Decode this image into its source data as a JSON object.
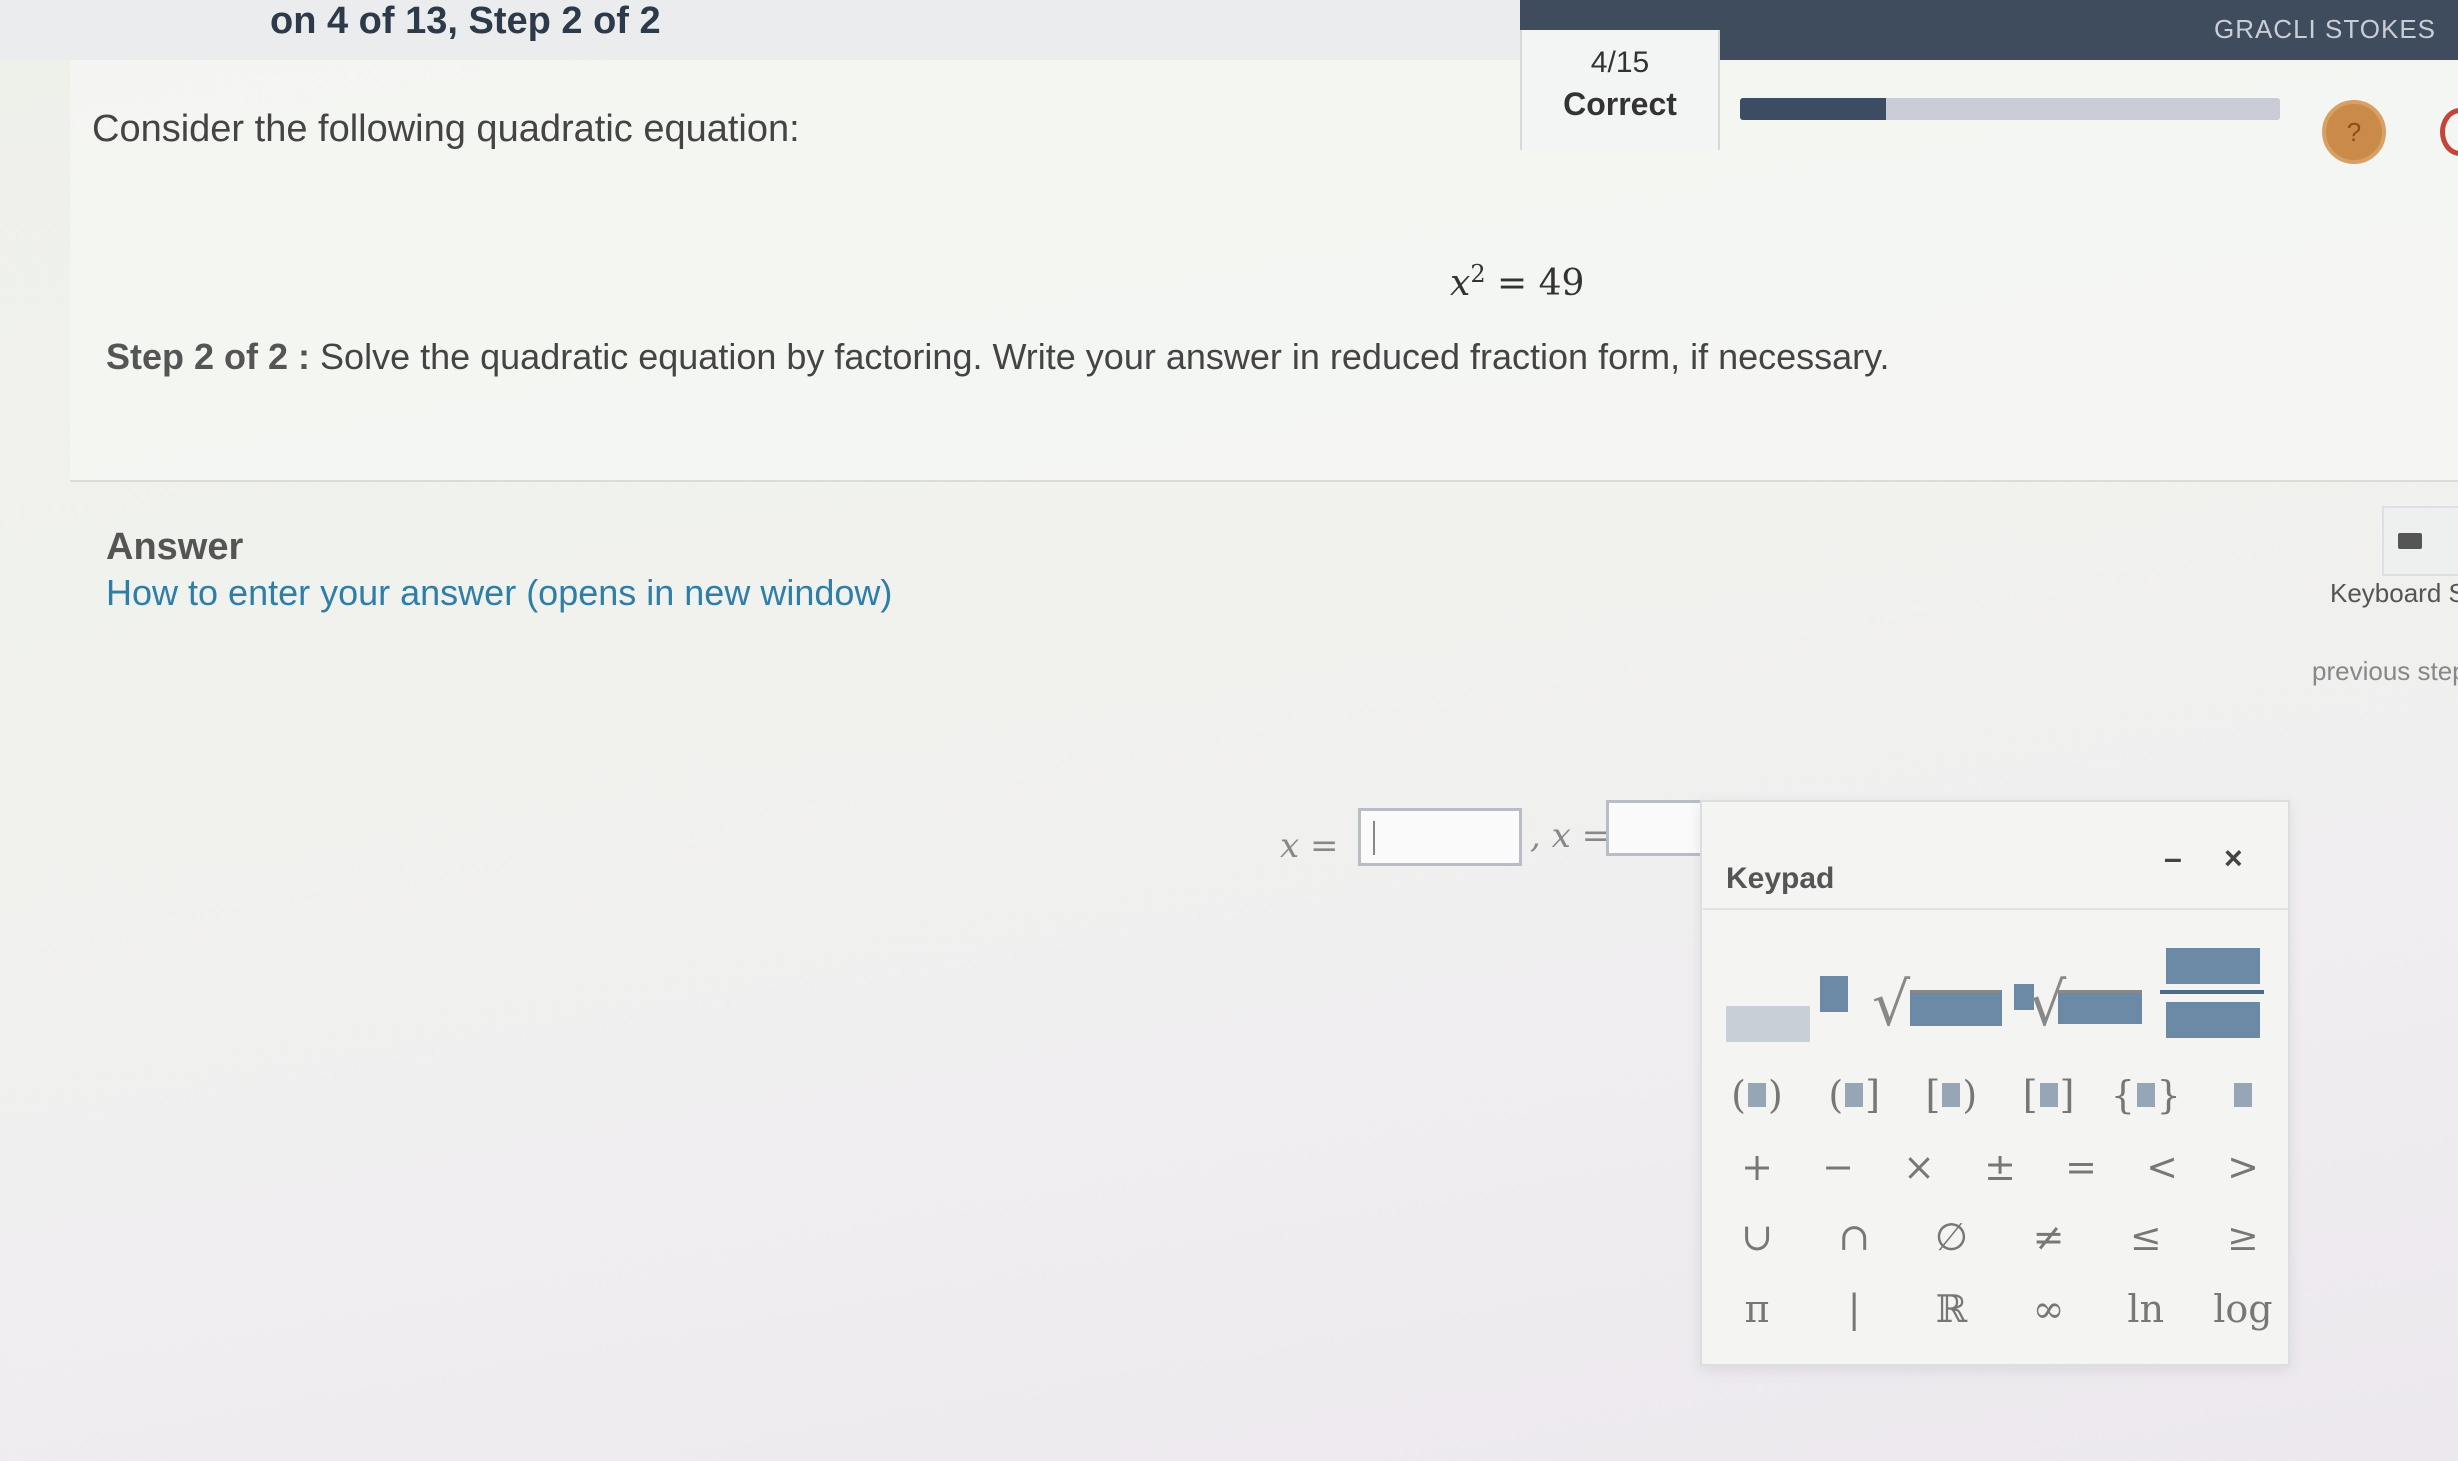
{
  "header": {
    "step_crumb": "on 4 of 13, Step 2 of 2",
    "user_name": "GRACLI STOKES",
    "score_count": "4/15",
    "score_status": "Correct",
    "progress_fraction": 0.27
  },
  "question": {
    "intro": "Consider the following quadratic equation:",
    "equation_base": "x",
    "equation_exp": "2",
    "equation_rest": " = 49",
    "step_label": "Step 2 of 2 :",
    "step_text": " Solve the quadratic equation by factoring. Write your answer in reduced fraction form, if necessary."
  },
  "answer": {
    "heading": "Answer",
    "help_link": "How to enter your answer (opens in new window)",
    "keyboard_shortcuts": "Keyboard Sh",
    "previous_step": "previous step",
    "input1_label": "x =",
    "input2_label": ", x ="
  },
  "keypad": {
    "title": "Keypad",
    "minimize": "–",
    "close": "×",
    "ops": [
      "+",
      "−",
      "×",
      "±",
      "=",
      "<",
      ">"
    ],
    "sets": [
      "∪",
      "∩",
      "∅",
      "≠",
      "≤",
      "≥"
    ],
    "consts": [
      "π",
      "|",
      "ℝ",
      "∞",
      "ln",
      "log"
    ]
  }
}
